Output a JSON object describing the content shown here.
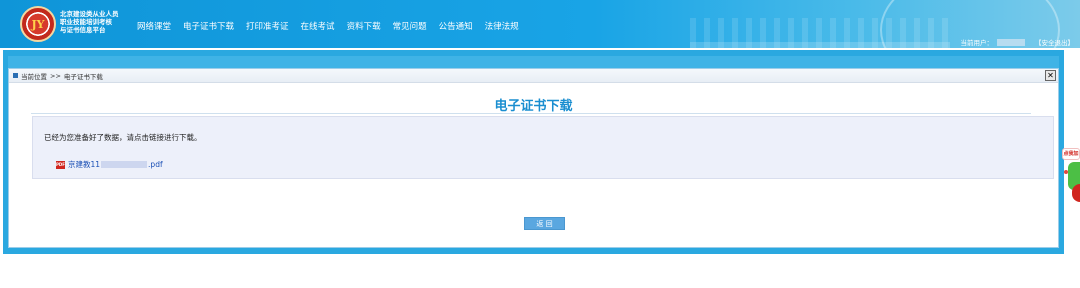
{
  "header": {
    "logo_text": "JY",
    "site_title": [
      "北京建设类从业人员",
      "职业技能培训考核",
      "与证书信息平台"
    ],
    "nav": [
      "网络课堂",
      "电子证书下载",
      "打印准考证",
      "在线考试",
      "资料下载",
      "常见问题",
      "公告通知",
      "法律法规"
    ],
    "user_label": "当前用户：",
    "logout_label": "【安全退出】"
  },
  "breadcrumb": {
    "prefix": "当前位置",
    "sep": ">>",
    "current": "电子证书下载"
  },
  "close_symbol": "✕",
  "main": {
    "heading": "电子证书下载",
    "info_text": "已经为您准备好了数据，请点击链接进行下载。",
    "file": {
      "name_prefix": "京建教11",
      "name_suffix": ".pdf",
      "icon_text": "PDF"
    },
    "back_label": "返 回"
  },
  "float_widget": {
    "badge_text": "点我加"
  },
  "colors": {
    "header_blue": "#19a4e6",
    "heading_blue": "#1a8ed0",
    "link_blue": "#1a4fb5",
    "button_blue": "#5aa7e0"
  }
}
